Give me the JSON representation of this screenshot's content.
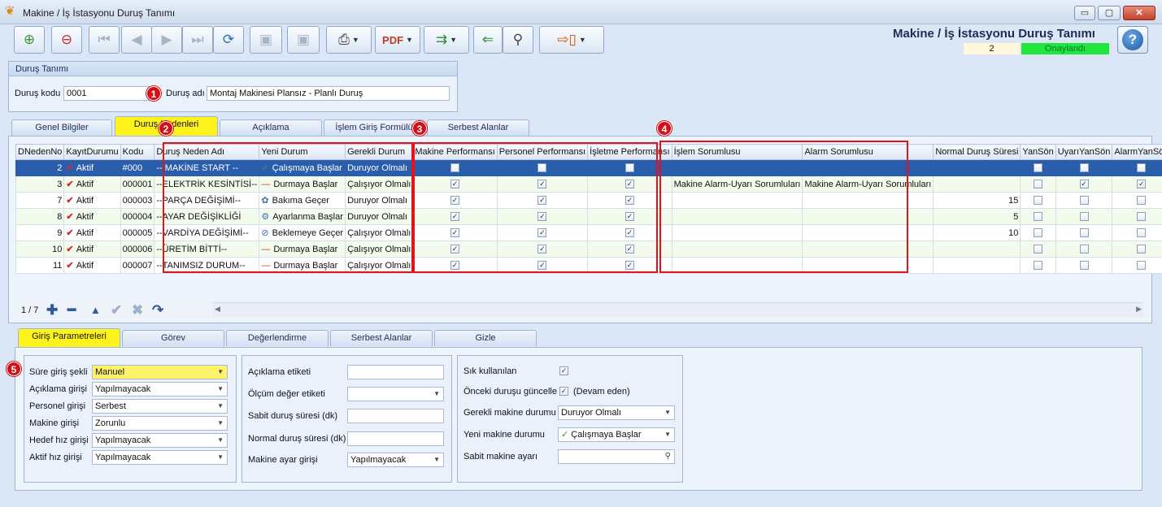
{
  "window": {
    "title": "Makine / İş İstasyonu Duruş Tanımı",
    "minimize": "▭",
    "maximize": "▢",
    "close": "✕"
  },
  "header": {
    "app_title": "Makine / İş İstasyonu Duruş Tanımı",
    "record_no": "2",
    "status": "Onaylandı",
    "status_color": "#21e63c"
  },
  "toolbar": {
    "icons": [
      "new-icon",
      "delete-icon",
      "first-icon",
      "prev-icon",
      "next-icon",
      "last-icon",
      "refresh-icon",
      "save-icon",
      "cancel-save-icon",
      "print-icon",
      "pdf-icon",
      "export-icon",
      "import-icon",
      "search-tool-icon",
      "exit-icon"
    ]
  },
  "durus": {
    "group_title": "Duruş Tanımı",
    "kod_label": "Duruş kodu",
    "kod_value": "0001",
    "adi_label": "Duruş adı",
    "adi_value": "Montaj Makinesi Plansız - Planlı Duruş"
  },
  "top_tabs": [
    "Genel Bilgiler",
    "Duruş Nedenleri",
    "Açıklama",
    "İşlem Giriş Formülü",
    "Serbest Alanlar"
  ],
  "badges": [
    "1",
    "2",
    "3",
    "4",
    "5"
  ],
  "grid": {
    "columns": [
      "DNedenNo",
      "KayıtDurumu",
      "Kodu",
      "Duruş Neden Adı",
      "Yeni Durum",
      "Gerekli Durum",
      "Makine Performansı",
      "Personel Performansı",
      "İşletme Performansı",
      "İşlem Sorumlusu",
      "Alarm Sorumlusu",
      "Normal Duruş Süresi",
      "YanSön",
      "UyarıYanSön",
      "AlarmYanSön"
    ],
    "rows": [
      {
        "no": "2",
        "kayit": "Aktif",
        "kodu": "#000",
        "ad": "-- MAKİNE START --",
        "yeni": "Çalışmaya Başlar",
        "yeni_icon": "✓",
        "gerekli": "Duruyor Olmalı",
        "mp": "",
        "pp": "",
        "ip": "",
        "islem": "",
        "alarm": "",
        "sure": "",
        "y": "",
        "u": "",
        "a": ""
      },
      {
        "no": "3",
        "kayit": "Aktif",
        "kodu": "000001",
        "ad": "--ELEKTRİK KESİNTİSİ--",
        "yeni": "Durmaya Başlar",
        "yeni_icon": "—",
        "gerekli": "Çalışıyor Olmalı",
        "mp": "✓",
        "pp": "✓",
        "ip": "✓",
        "islem": "Makine Alarm-Uyarı Sorumluları",
        "alarm": "Makine Alarm-Uyarı Sorumluları",
        "sure": "",
        "y": "",
        "u": "✓",
        "a": "✓"
      },
      {
        "no": "7",
        "kayit": "Aktif",
        "kodu": "000003",
        "ad": "--PARÇA DEĞİŞİMİ--",
        "yeni": "Bakıma Geçer",
        "yeni_icon": "✿",
        "gerekli": "Duruyor Olmalı",
        "mp": "✓",
        "pp": "✓",
        "ip": "✓",
        "islem": "",
        "alarm": "",
        "sure": "15",
        "y": "",
        "u": "",
        "a": ""
      },
      {
        "no": "8",
        "kayit": "Aktif",
        "kodu": "000004",
        "ad": "--AYAR DEĞİŞİKLİĞİ",
        "yeni": "Ayarlanma Başlar",
        "yeni_icon": "⚙",
        "gerekli": "Duruyor Olmalı",
        "mp": "✓",
        "pp": "✓",
        "ip": "✓",
        "islem": "",
        "alarm": "",
        "sure": "5",
        "y": "",
        "u": "",
        "a": ""
      },
      {
        "no": "9",
        "kayit": "Aktif",
        "kodu": "000005",
        "ad": "--VARDİYA DEĞİŞİMİ--",
        "yeni": "Beklemeye Geçer",
        "yeni_icon": "⊘",
        "gerekli": "Çalışıyor Olmalı",
        "mp": "✓",
        "pp": "✓",
        "ip": "✓",
        "islem": "",
        "alarm": "",
        "sure": "10",
        "y": "",
        "u": "",
        "a": ""
      },
      {
        "no": "10",
        "kayit": "Aktif",
        "kodu": "000006",
        "ad": "--ÜRETİM BİTTİ--",
        "yeni": "Durmaya Başlar",
        "yeni_icon": "—",
        "gerekli": "Çalışıyor Olmalı",
        "mp": "✓",
        "pp": "✓",
        "ip": "✓",
        "islem": "",
        "alarm": "",
        "sure": "",
        "y": "",
        "u": "",
        "a": ""
      },
      {
        "no": "11",
        "kayit": "Aktif",
        "kodu": "000007",
        "ad": "--TANIMSIZ DURUM--",
        "yeni": "Durmaya Başlar",
        "yeni_icon": "—",
        "gerekli": "Çalışıyor Olmalı",
        "mp": "✓",
        "pp": "✓",
        "ip": "✓",
        "islem": "",
        "alarm": "",
        "sure": "",
        "y": "",
        "u": "",
        "a": ""
      }
    ],
    "record_counter": "1 / 7"
  },
  "bottom_tabs": [
    "Giriş Parametreleri",
    "Görev",
    "Değerlendirme",
    "Serbest Alanlar",
    "Gizle"
  ],
  "params": {
    "col1": [
      {
        "label": "Süre giriş şekli",
        "value": "Manuel"
      },
      {
        "label": "Açıklama girişi",
        "value": "Yapılmayacak"
      },
      {
        "label": "Personel girişi",
        "value": "Serbest"
      },
      {
        "label": "Makine girişi",
        "value": "Zorunlu"
      },
      {
        "label": "Hedef hız girişi",
        "value": "Yapılmayacak"
      },
      {
        "label": "Aktif hız girişi",
        "value": "Yapılmayacak"
      }
    ],
    "col2": [
      {
        "label": "Açıklama etiketi",
        "value": ""
      },
      {
        "label": "Ölçüm değer etiketi",
        "value": ""
      },
      {
        "label": "Sabit duruş süresi (dk)",
        "value": ""
      },
      {
        "label": "Normal duruş süresi (dk)",
        "value": ""
      },
      {
        "label": "Makine ayar girişi",
        "value": "Yapılmayacak"
      }
    ],
    "col3": {
      "sik_label": "Sık kullanılan",
      "sik_checked": "✓",
      "onceki_label": "Önceki duruşu güncelle",
      "onceki_checked": "✓",
      "onceki_suffix": "(Devam eden)",
      "gerekli_label": "Gerekli makine durumu",
      "gerekli_value": "Duruyor Olmalı",
      "yeni_label": "Yeni makine durumu",
      "yeni_value": "Çalışmaya Başlar",
      "sabit_label": "Sabit makine ayarı",
      "sabit_value": ""
    }
  }
}
